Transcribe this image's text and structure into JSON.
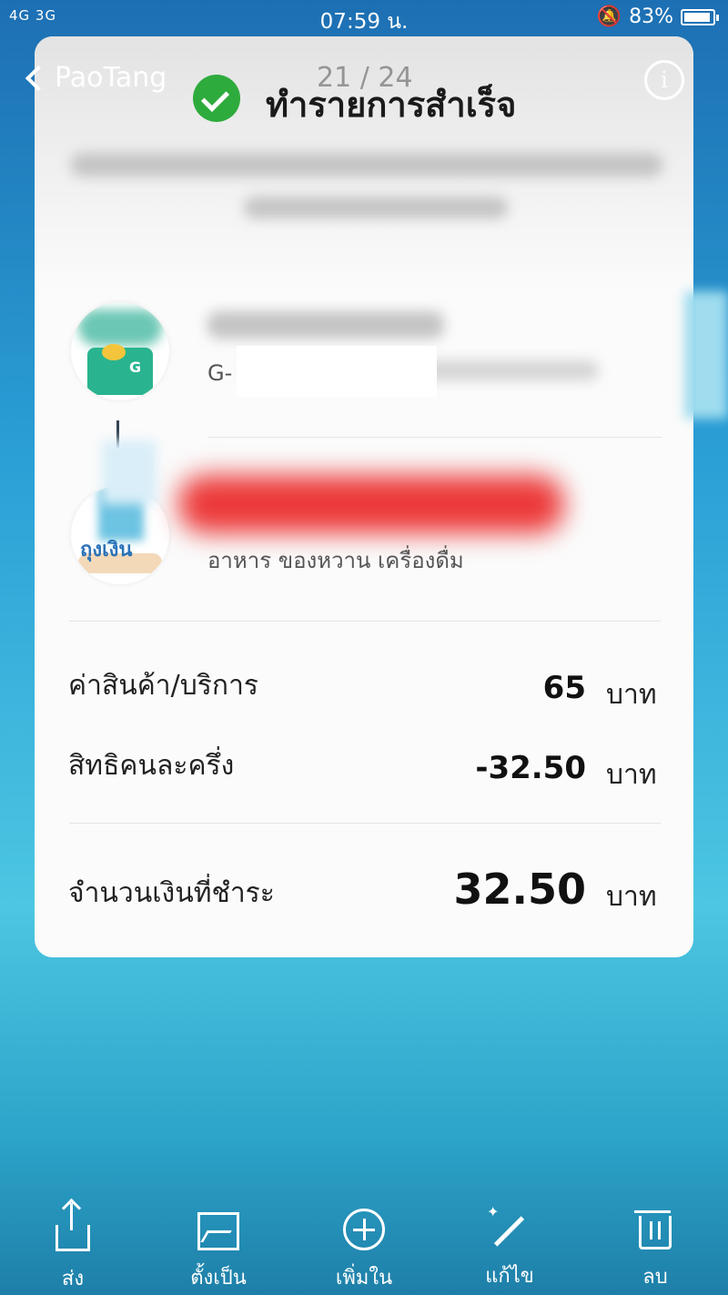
{
  "status_bar": {
    "network": "4G 3G",
    "time": "07:59 น.",
    "battery_percent": "83%",
    "battery_level": 0.83
  },
  "viewer": {
    "back_label": "PaoTang",
    "counter": "21 / 24"
  },
  "receipt": {
    "title": "ทำรายการสำเร็จ",
    "sender_prefix": "G-",
    "merchant_category": "อาหาร ของหวาน เครื่องดื่ม",
    "rows": [
      {
        "label": "ค่าสินค้า/บริการ",
        "value": "65",
        "unit": "บาท"
      },
      {
        "label": "สิทธิคนละครึ่ง",
        "value": "-32.50",
        "unit": "บาท"
      }
    ],
    "total": {
      "label": "จำนวนเงินที่ชำระ",
      "value": "32.50",
      "unit": "บาท"
    }
  },
  "actions": [
    {
      "label": "ส่ง",
      "icon": "share-icon"
    },
    {
      "label": "ตั้งเป็น",
      "icon": "wallpaper-icon"
    },
    {
      "label": "เพิ่มใน",
      "icon": "add-icon"
    },
    {
      "label": "แก้ไข",
      "icon": "edit-icon"
    },
    {
      "label": "ลบ",
      "icon": "trash-icon"
    }
  ],
  "colors": {
    "success_green": "#2eab3d",
    "redaction_red": "#ec3939",
    "background_blue": "#2a9fd6"
  }
}
